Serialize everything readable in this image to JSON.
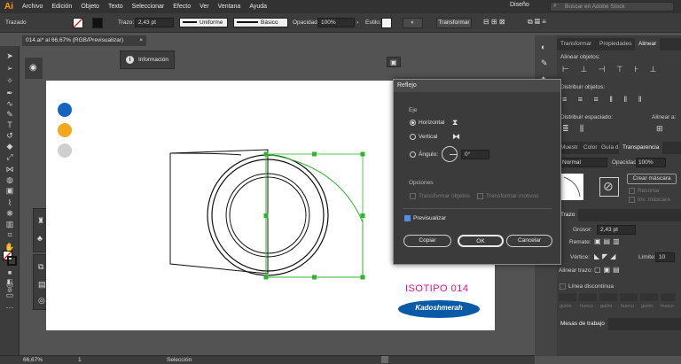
{
  "app": {
    "logo": "Ai"
  },
  "menu": [
    "Archivo",
    "Edición",
    "Objeto",
    "Texto",
    "Seleccionar",
    "Efecto",
    "Ver",
    "Ventana",
    "Ayuda"
  ],
  "workspace": "Diseño",
  "stock_search_placeholder": "Buscar en Adobe Stock",
  "control": {
    "object_type": "Trazado",
    "stroke_label": "Trazo:",
    "stroke_value": "2,43 pt",
    "profile": "Uniforme",
    "brush": "Básico",
    "opacity_label": "Opacidad:",
    "opacity_value": "100%",
    "style_label": "Estilo:",
    "transform_button": "Transformar"
  },
  "document_tab": "014.ai* al 66,67% (RGB/Previsualizar)",
  "info_panel": {
    "label": "Información"
  },
  "artboard": {
    "title_text": "ISOTIPO 014",
    "badge_text": "Kadoshmerah",
    "swatches": [
      "#1565c0",
      "#f2a81d",
      "#cfcfcf"
    ]
  },
  "dialog": {
    "title": "Reflejo",
    "axis_label": "Eje",
    "horizontal": "Horizontal",
    "vertical": "Vertical",
    "angle_label": "Ángulo:",
    "angle_value": "0°",
    "options_label": "Opciones",
    "transform_objects": "Transformar objetos",
    "transform_patterns": "Transformar motivos",
    "preview_label": "Previsualizar",
    "copy_button": "Copiar",
    "ok_button": "OK",
    "cancel_button": "Cancelar"
  },
  "right_panel": {
    "tabs_top": [
      "Transformar",
      "Propiedades",
      "Alinear"
    ],
    "align_objects": "Alinear objetos:",
    "distribute_objects": "Distribuir objetos:",
    "distribute_spacing": "Distribuir espaciado:",
    "align_to": "Alinear a:",
    "tabs_mid": [
      "Muestr",
      "Color",
      "Guía d",
      "Transparencia"
    ],
    "blend_mode": "Normal",
    "opacity_label": "Opacidad:",
    "opacity_value": "100%",
    "create_mask": "Crear máscara",
    "clip": "Recortar",
    "invert_mask": "Inv. máscara",
    "stroke_tab": "Trazo",
    "weight_label": "Grosor:",
    "weight_value": "2,43 pt",
    "cap_label": "Remate:",
    "corner_label": "Vértice:",
    "limit_label": "Límite:",
    "limit_value": "10",
    "align_stroke": "Alinear trazo:",
    "dashed_line": "Línea discontinua",
    "dash_labels": [
      "guión",
      "hueco",
      "guión",
      "hueco",
      "guión",
      "hueco"
    ],
    "workspace_libraries": "Mesas de trabajo"
  },
  "status": {
    "zoom": "66,67%",
    "page": "1",
    "tool": "Selección"
  }
}
